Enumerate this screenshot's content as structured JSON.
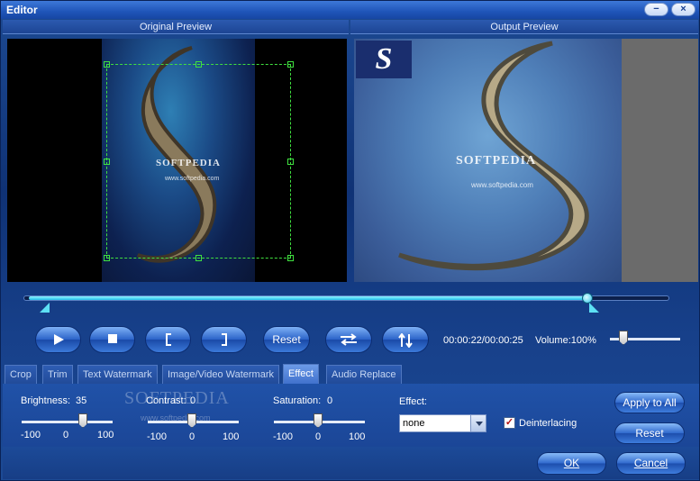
{
  "window": {
    "title": "Editor",
    "minimize_label": "−",
    "close_label": "×"
  },
  "preview": {
    "original_label": "Original Preview",
    "output_label": "Output Preview",
    "watermark_text": "SOFTPEDIA",
    "watermark_url": "www.softpedia.com",
    "output_badge": "S"
  },
  "timeline": {
    "position_fraction": 0.87,
    "current_time": "00:00:22",
    "total_time": "00:00:25",
    "time_display": "00:00:22/00:00:25"
  },
  "transport": {
    "reset_label": "Reset",
    "volume_label": "Volume:100%",
    "volume_fraction": 0.15
  },
  "tabs": [
    {
      "label": "Crop",
      "active": false
    },
    {
      "label": "Trim",
      "active": false
    },
    {
      "label": "Text Watermark",
      "active": false
    },
    {
      "label": "Image/Video Watermark",
      "active": false
    },
    {
      "label": "Effect",
      "active": true
    },
    {
      "label": "Audio Replace",
      "active": false
    }
  ],
  "effect": {
    "brightness_label": "Brightness:",
    "brightness_value": "35",
    "contrast_label": "Contrast:",
    "contrast_value": "0",
    "saturation_label": "Saturation:",
    "saturation_value": "0",
    "range_min": "-100",
    "range_mid": "0",
    "range_max": "100",
    "effect_label": "Effect:",
    "effect_selected": "none",
    "deinterlacing_label": "Deinterlacing",
    "deinterlacing_checked": true,
    "apply_to_all_label": "Apply to All",
    "reset_label": "Reset"
  },
  "footer": {
    "ok_label": "OK",
    "cancel_label": "Cancel"
  },
  "background_watermark": {
    "text": "SOFTPEDIA",
    "url": "www.softpedia.com"
  },
  "colors": {
    "accent": "#2a62c8",
    "timeline_fill": "#23c0ea",
    "crop_box": "#3fe03f"
  }
}
